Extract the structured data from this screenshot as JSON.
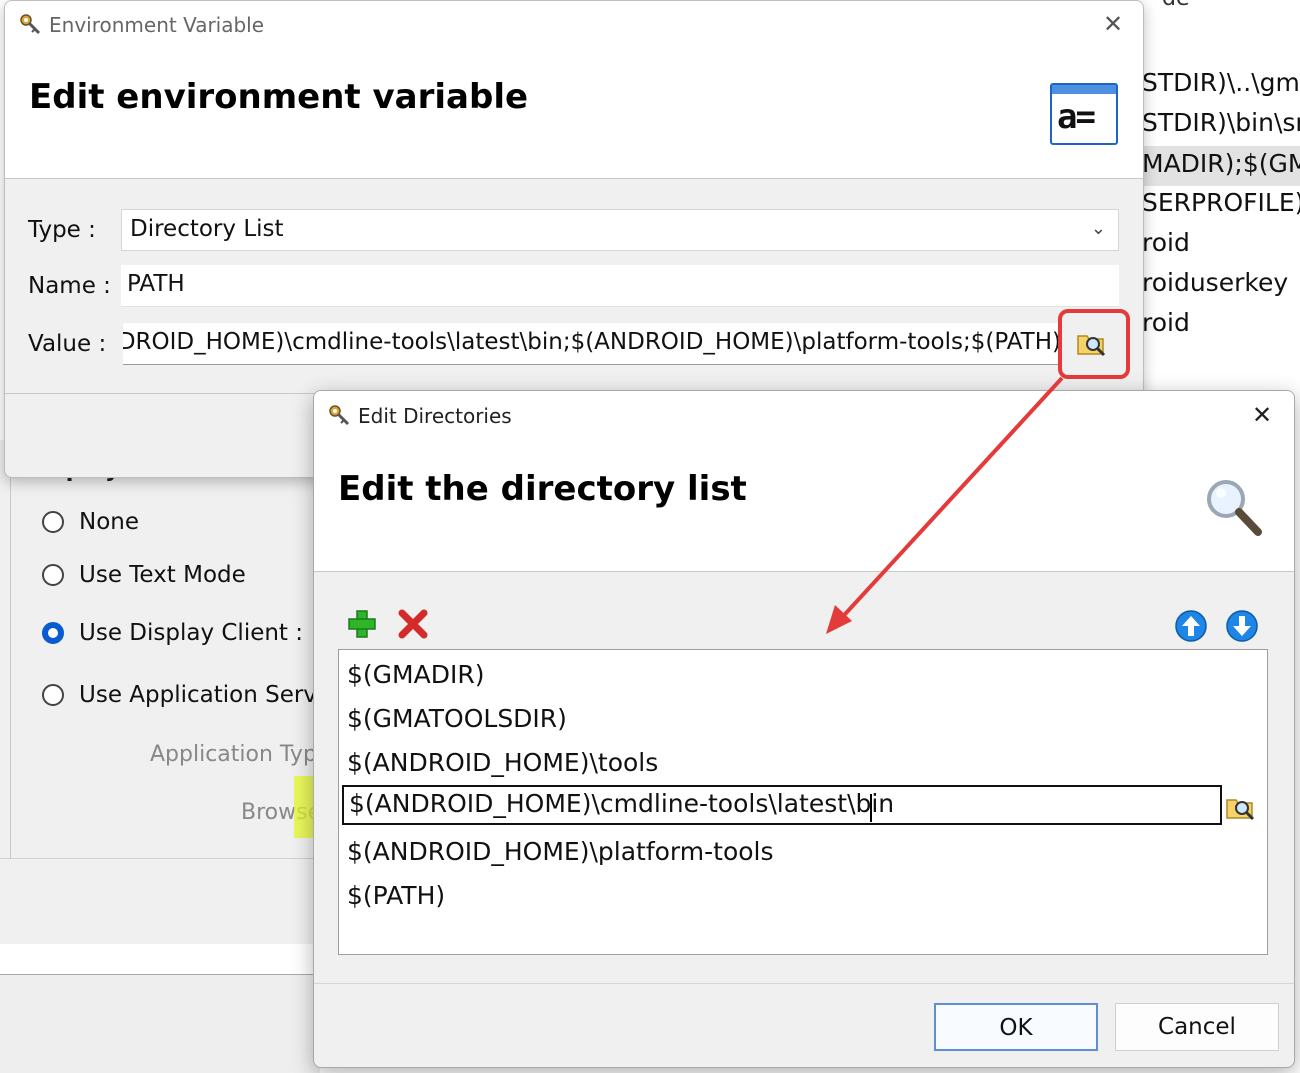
{
  "background_right": {
    "top_fragment": "de",
    "lines": [
      "STDIR)\\..\\gma",
      "STDIR)\\bin\\src",
      "MADIR);$(GM",
      "SERPROFILE)\\.",
      "roid",
      "roiduserkey",
      "roid"
    ]
  },
  "background_left": {
    "section_label": "Display",
    "radios": [
      {
        "label": "None",
        "checked": false
      },
      {
        "label": "Use Text Mode",
        "checked": false
      },
      {
        "label": "Use Display Client :",
        "checked": true
      },
      {
        "label": "Use Application Server",
        "checked": false
      }
    ],
    "app_type_label": "Application Typ",
    "browse_label": "Browse"
  },
  "env_dialog": {
    "window_title": "Environment Variable",
    "heading": "Edit environment variable",
    "type_label": "Type :",
    "type_value": "Directory List",
    "name_label": "Name :",
    "name_value": "PATH",
    "value_label": "Value :",
    "value_value": "ANDROID_HOME)\\cmdline-tools\\latest\\bin;$(ANDROID_HOME)\\platform-tools;$(PATH)"
  },
  "dir_dialog": {
    "window_title": "Edit Directories",
    "heading": "Edit the directory list",
    "items": [
      "$(GMADIR)",
      "$(GMATOOLSDIR)",
      "$(ANDROID_HOME)\\tools",
      "$(ANDROID_HOME)\\cmdline-tools\\latest\\bin",
      "$(ANDROID_HOME)\\platform-tools",
      "$(PATH)"
    ],
    "editing_index": 3,
    "ok_label": "OK",
    "cancel_label": "Cancel"
  },
  "colors": {
    "annotation_red": "#e53a3a",
    "highlight_yellow": "#e6fa28",
    "radio_blue": "#0a5bd1"
  },
  "icons": [
    "key-icon",
    "close-icon",
    "variable-icon",
    "browse-folder-icon",
    "magnifier-icon",
    "add-icon",
    "delete-icon",
    "move-up-icon",
    "move-down-icon",
    "chevron-down-icon"
  ]
}
